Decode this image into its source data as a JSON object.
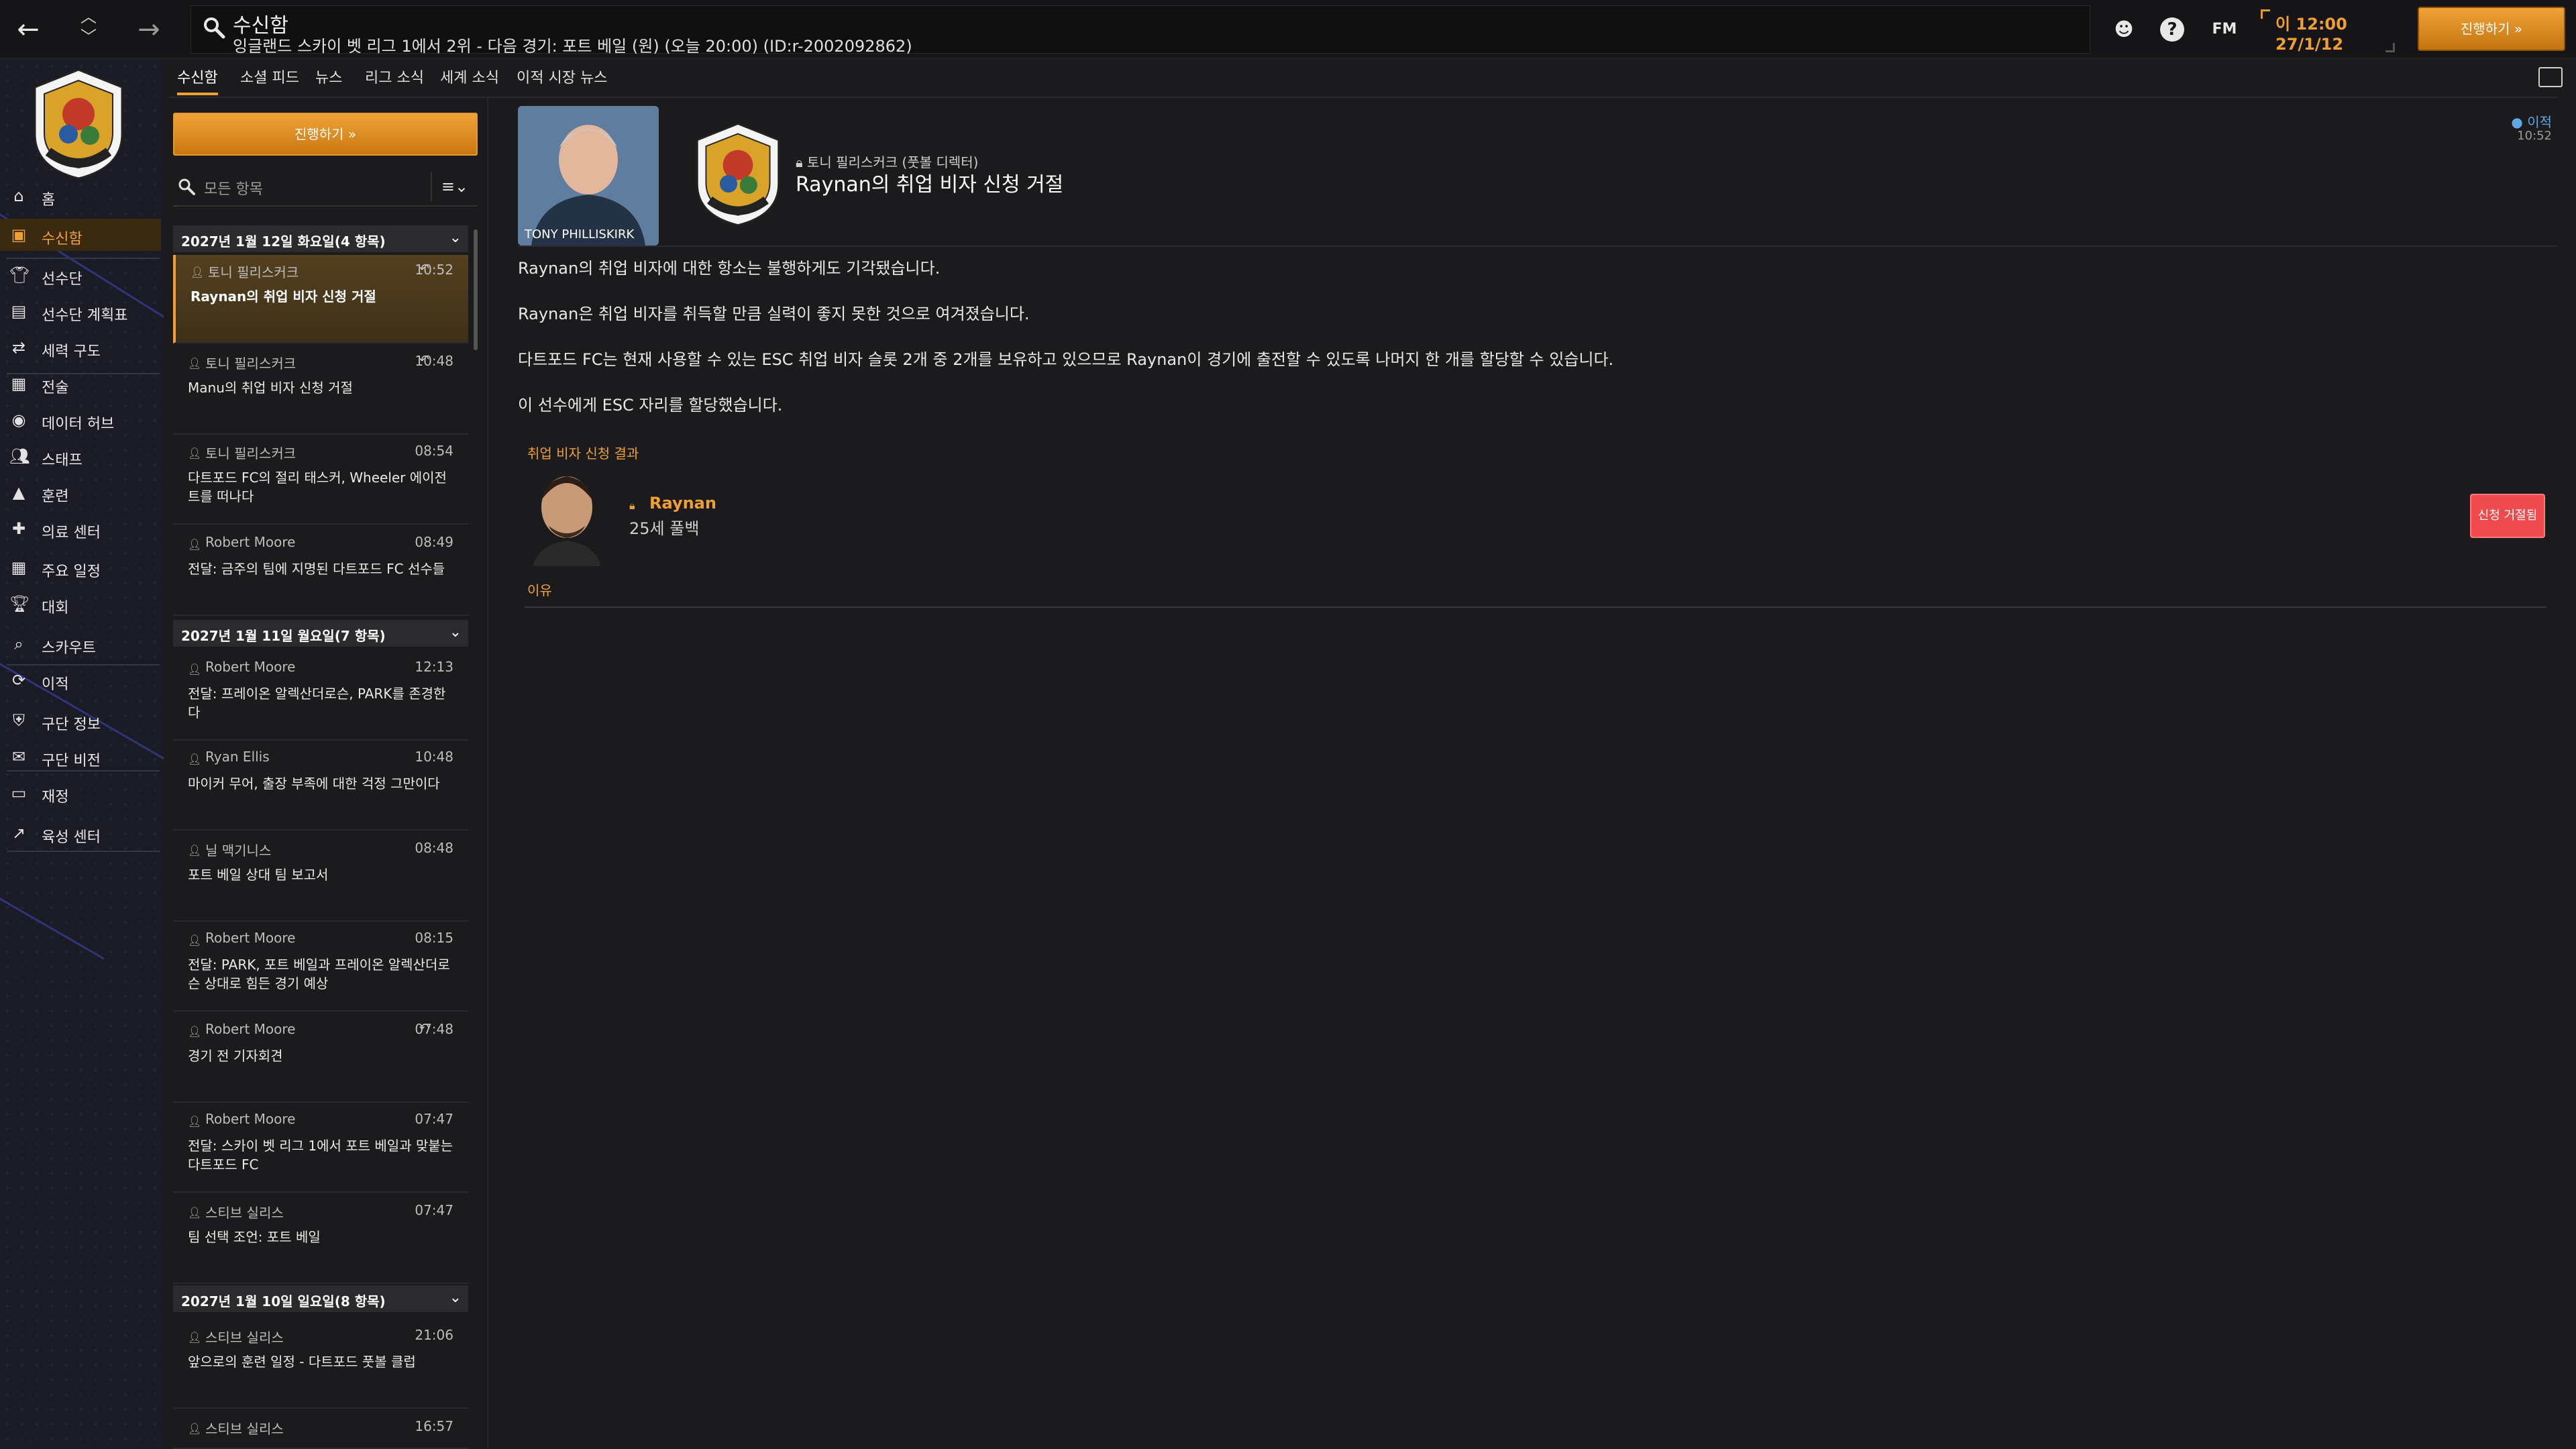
{
  "header": {
    "title": "수신함",
    "subtitle": "잉글랜드 스카이 벳 리그 1에서 2위 - 다음 경기: 포트 베일 (원) (오늘 20:00) (ID:r-2002092862)",
    "fm_label": "FM",
    "time": "이 12:00",
    "date": "27/1/12",
    "continue_label": "진행하기 »"
  },
  "sidebar": {
    "items": [
      {
        "label": "홈",
        "icon": "home-icon"
      },
      {
        "label": "수신함",
        "icon": "inbox-icon"
      },
      {
        "label": "선수단",
        "icon": "shirt-icon"
      },
      {
        "label": "선수단 계획표",
        "icon": "clipboard-icon"
      },
      {
        "label": "세력 구도",
        "icon": "dynamics-icon"
      },
      {
        "label": "전술",
        "icon": "tactics-icon"
      },
      {
        "label": "데이터 허브",
        "icon": "data-hub-icon"
      },
      {
        "label": "스태프",
        "icon": "staff-icon"
      },
      {
        "label": "훈련",
        "icon": "training-icon"
      },
      {
        "label": "의료 센터",
        "icon": "medical-icon"
      },
      {
        "label": "주요 일정",
        "icon": "calendar-icon"
      },
      {
        "label": "대회",
        "icon": "trophy-icon"
      },
      {
        "label": "스카우트",
        "icon": "scout-icon"
      },
      {
        "label": "이적",
        "icon": "transfer-icon"
      },
      {
        "label": "구단 정보",
        "icon": "shield-icon"
      },
      {
        "label": "구단 비전",
        "icon": "vision-icon"
      },
      {
        "label": "재정",
        "icon": "finance-icon"
      },
      {
        "label": "육성 센터",
        "icon": "development-icon"
      }
    ]
  },
  "tabs": [
    "수신함",
    "소셜 피드",
    "뉴스",
    "리그 소식",
    "세계 소식",
    "이적 시장 뉴스"
  ],
  "list": {
    "continue_label": "진행하기 »",
    "filter_placeholder": "모든 항목",
    "groups": [
      {
        "label": "2027년 1월 12일 화요일(4 항목)"
      },
      {
        "label": "2027년 1월 11일 월요일(7 항목)"
      },
      {
        "label": "2027년 1월 10일 일요일(8 항목)"
      }
    ],
    "messages": [
      {
        "sender": "토니 필리스커크",
        "time": "10:52",
        "subject": "Raynan의 취업 비자 신청 거절"
      },
      {
        "sender": "토니 필리스커크",
        "time": "10:48",
        "subject": "Manu의 취업 비자 신청 거절"
      },
      {
        "sender": "토니 필리스커크",
        "time": "08:54",
        "subject": "다트포드 FC의 절리 태스커, Wheeler 에이전트를 떠나다"
      },
      {
        "sender": "Robert Moore",
        "time": "08:49",
        "subject": "전달: 금주의 팀에 지명된 다트포드 FC 선수들"
      },
      {
        "sender": "Robert Moore",
        "time": "12:13",
        "subject": "전달: 프레이온 알렉산더로슨, PARK를 존경한다"
      },
      {
        "sender": "Ryan Ellis",
        "time": "10:48",
        "subject": "마이커 무어, 출장 부족에 대한 걱정 그만이다"
      },
      {
        "sender": "닐 맥기니스",
        "time": "08:48",
        "subject": "포트 베일 상대 팀 보고서"
      },
      {
        "sender": "Robert Moore",
        "time": "08:15",
        "subject": "전달: PARK, 포트 베일과 프레이온 알렉산더로슨 상대로 힘든 경기 예상"
      },
      {
        "sender": "Robert Moore",
        "time": "07:48",
        "subject": "경기 전 기자회견"
      },
      {
        "sender": "Robert Moore",
        "time": "07:47",
        "subject": "전달: 스카이 벳 리그 1에서 포트 베일과 맞붙는 다트포드 FC"
      },
      {
        "sender": "스티브 실리스",
        "time": "07:47",
        "subject": "팀 선택 조언: 포트 베일"
      },
      {
        "sender": "스티브 실리스",
        "time": "21:06",
        "subject": "앞으로의 훈련 일정 - 다트포드 풋볼 클럽"
      },
      {
        "sender": "스티브 실리스",
        "time": "16:57",
        "subject": ""
      }
    ]
  },
  "detail": {
    "photo_caption": "TONY PHILLISKIRK",
    "from": "토니 필리스커크 (풋볼 디렉터)",
    "subject": "Raynan의 취업 비자 신청 거절",
    "tag": "이적",
    "tag_time": "10:52",
    "paragraphs": [
      "Raynan의 취업 비자에 대한 항소는 불행하게도 기각됐습니다.",
      "Raynan은 취업 비자를 취득할 만큼 실력이 좋지 못한 것으로 여겨졌습니다.",
      "다트포드 FC는 현재 사용할 수 있는 ESC 취업 비자 슬롯 2개 중 2개를 보유하고 있으므로 Raynan이 경기에 출전할 수 있도록 나머지 한 개를 할당할 수 있습니다.",
      "이 선수에게 ESC 자리를 할당했습니다."
    ],
    "visa_result_title": "취업 비자 신청 결과",
    "player_name": "Raynan",
    "player_info": "25세 풀백",
    "status_badge": "신청 거절됨",
    "reason_label": "이유"
  },
  "colors": {
    "accent": "#f0a032",
    "rejected": "#ef4b4f",
    "link_blue": "#5fa8e6"
  }
}
